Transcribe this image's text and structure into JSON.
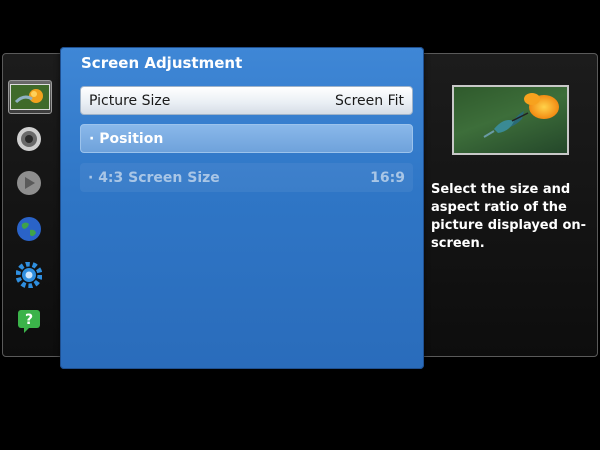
{
  "menu": {
    "title": "Screen Adjustment",
    "items": [
      {
        "label": "Picture Size",
        "value": "Screen Fit",
        "state": "selected"
      },
      {
        "label": "· Position",
        "value": "",
        "state": "focused"
      },
      {
        "label": "· 4:3 Screen Size",
        "value": "16:9",
        "state": "disabled"
      }
    ]
  },
  "sidebar": {
    "items": [
      {
        "name": "picture-icon",
        "selected": true
      },
      {
        "name": "sound-icon"
      },
      {
        "name": "broadcast-icon"
      },
      {
        "name": "network-globe-icon"
      },
      {
        "name": "system-gear-icon"
      },
      {
        "name": "support-help-icon"
      }
    ]
  },
  "help": {
    "text": "Select the size and aspect ratio of the picture displayed on-screen."
  },
  "colors": {
    "panel_blue": "#2f76c6",
    "highlight": "#ffffff",
    "focus_blue": "#7aaee2"
  }
}
